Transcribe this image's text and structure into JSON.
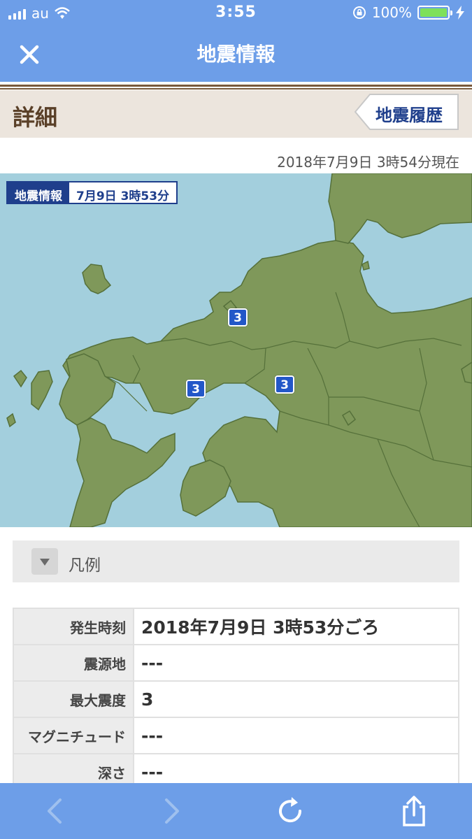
{
  "status_bar": {
    "carrier": "au",
    "time": "3:55",
    "battery": "100%"
  },
  "nav": {
    "title": "地震情報"
  },
  "section": {
    "title": "詳細",
    "history_button": "地震履歴"
  },
  "timestamp": "2018年7月9日 3時54分現在",
  "map": {
    "tag_label": "地震情報",
    "tag_time": "7月9日 3時53分",
    "markers": [
      {
        "intensity": "3"
      },
      {
        "intensity": "3"
      },
      {
        "intensity": "3"
      }
    ]
  },
  "legend": {
    "label": "凡例"
  },
  "details": [
    {
      "label": "発生時刻",
      "value": "2018年7月9日 3時53分ごろ"
    },
    {
      "label": "震源地",
      "value": "---"
    },
    {
      "label": "最大震度",
      "value": "3"
    },
    {
      "label": "マグニチュード",
      "value": "---"
    },
    {
      "label": "深さ",
      "value": "---"
    }
  ],
  "colors": {
    "bar_blue": "#6d9ee8",
    "navy": "#1f3f8c",
    "land": "#7f985a",
    "sea": "#a3cfdd",
    "marker": "#2357c8"
  }
}
